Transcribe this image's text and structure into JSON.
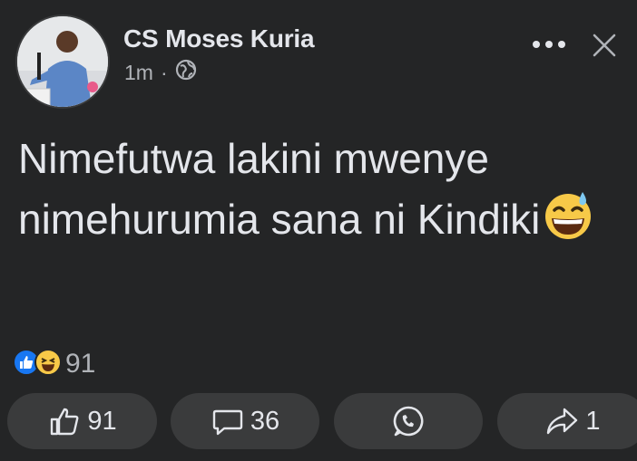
{
  "post": {
    "author": "CS Moses Kuria",
    "timestamp": "1m",
    "separator": "·",
    "privacy_icon": "globe-icon",
    "text": "Nimefutwa lakini mwenye nimehurumia sana ni Kindiki",
    "emoji": "grinning-sweat-emoji"
  },
  "reactions": {
    "icons": [
      "like-reaction-icon",
      "haha-reaction-icon"
    ],
    "count": "91"
  },
  "actions": {
    "like_count": "91",
    "comment_count": "36",
    "whatsapp_icon": "whatsapp-icon",
    "share_count": "1"
  },
  "colors": {
    "background": "#242526",
    "button_bg": "#3a3b3c",
    "text_primary": "#e4e6eb",
    "text_secondary": "#b0b3b8",
    "like_blue": "#1877f2",
    "emoji_yellow": "#f7c948"
  }
}
